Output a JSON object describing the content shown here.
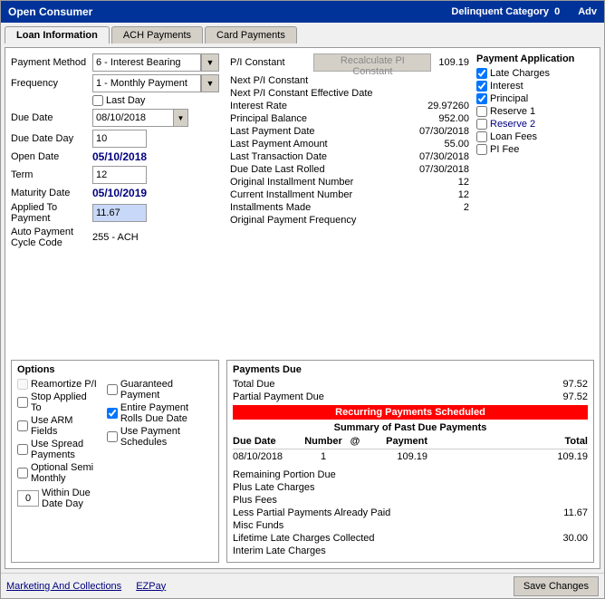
{
  "window": {
    "title": "Open Consumer",
    "delinquent_label": "Delinquent Category",
    "delinquent_value": "0",
    "adv_label": "Adv"
  },
  "tabs": [
    {
      "label": "Loan Information",
      "active": true
    },
    {
      "label": "ACH Payments",
      "active": false
    },
    {
      "label": "Card Payments",
      "active": false
    }
  ],
  "loan_info": {
    "payment_method_label": "Payment Method",
    "payment_method_value": "6 - Interest Bearing",
    "frequency_label": "Frequency",
    "frequency_value": "1 - Monthly Payment",
    "last_day_label": "Last Day",
    "due_date_label": "Due Date",
    "due_date_value": "08/10/2018",
    "due_date_day_label": "Due Date Day",
    "due_date_day_value": "10",
    "open_date_label": "Open Date",
    "open_date_value": "05/10/2018",
    "term_label": "Term",
    "term_value": "12",
    "maturity_date_label": "Maturity Date",
    "maturity_date_value": "05/10/2019",
    "applied_label": "Applied To Payment",
    "applied_value": "11.67",
    "auto_payment_label": "Auto Payment Cycle Code",
    "auto_payment_value": "255 - ACH"
  },
  "pi_section": {
    "pi_constant_label": "P/I Constant",
    "recalc_label": "Recalculate PI Constant",
    "pi_value": "109.19",
    "next_pi_label": "Next P/I Constant",
    "next_pi_eff_label": "Next P/I Constant Effective Date",
    "interest_rate_label": "Interest Rate",
    "interest_rate_value": "29.97260",
    "principal_balance_label": "Principal Balance",
    "principal_balance_value": "952.00",
    "last_payment_date_label": "Last Payment Date",
    "last_payment_date_value": "07/30/2018",
    "last_payment_amount_label": "Last Payment Amount",
    "last_payment_amount_value": "55.00",
    "last_transaction_label": "Last Transaction Date",
    "last_transaction_value": "07/30/2018",
    "due_date_rolled_label": "Due Date Last Rolled",
    "due_date_rolled_value": "07/30/2018",
    "original_installment_label": "Original Installment Number",
    "original_installment_value": "12",
    "current_installment_label": "Current Installment Number",
    "current_installment_value": "12",
    "installments_made_label": "Installments Made",
    "installments_made_value": "2",
    "original_freq_label": "Original Payment Frequency"
  },
  "payment_application": {
    "title": "Payment Application",
    "items": [
      {
        "label": "Late Charges",
        "checked": true,
        "color": "normal"
      },
      {
        "label": "Interest",
        "checked": true,
        "color": "normal"
      },
      {
        "label": "Principal",
        "checked": true,
        "color": "normal"
      },
      {
        "label": "Reserve 1",
        "checked": false,
        "color": "normal"
      },
      {
        "label": "Reserve 2",
        "checked": false,
        "color": "blue"
      },
      {
        "label": "Loan Fees",
        "checked": false,
        "color": "normal"
      },
      {
        "label": "PI Fee",
        "checked": false,
        "color": "normal"
      }
    ]
  },
  "options": {
    "title": "Options",
    "col1": [
      {
        "label": "Reamortize P/I",
        "checked": false,
        "disabled": true
      },
      {
        "label": "Stop Applied To",
        "checked": false
      },
      {
        "label": "Use ARM Fields",
        "checked": false
      },
      {
        "label": "Use Spread Payments",
        "checked": false
      },
      {
        "label": "Optional Semi Monthly",
        "checked": false
      }
    ],
    "col2": [
      {
        "label": "Guaranteed Payment",
        "checked": false
      },
      {
        "label": "Entire Payment Rolls Due Date",
        "checked": true
      },
      {
        "label": "Use Payment Schedules",
        "checked": false
      }
    ],
    "within_label": "Within Due Date Day",
    "within_value": "0"
  },
  "payments_due": {
    "title": "Payments Due",
    "total_due_label": "Total Due",
    "total_due_value": "97.52",
    "partial_due_label": "Partial Payment Due",
    "partial_due_value": "97.52",
    "recurring_label": "Recurring Payments Scheduled",
    "summary_title": "Summary of Past Due Payments",
    "table_headers": [
      "Due Date",
      "Number",
      "@",
      "Payment",
      "Total"
    ],
    "table_rows": [
      {
        "due_date": "08/10/2018",
        "number": "1",
        "at": "",
        "payment": "109.19",
        "total": "109.19"
      }
    ],
    "misc": [
      {
        "label": "Remaining Portion Due",
        "value": ""
      },
      {
        "label": "Plus Late Charges",
        "value": ""
      },
      {
        "label": "Plus Fees",
        "value": ""
      },
      {
        "label": "Less Partial Payments Already Paid",
        "value": "11.67"
      },
      {
        "label": "Misc Funds",
        "value": ""
      },
      {
        "label": "Lifetime Late Charges Collected",
        "value": "30.00"
      },
      {
        "label": "Interim Late Charges",
        "value": ""
      }
    ]
  },
  "bottom_bar": {
    "link1": "Marketing And Collections",
    "link2": "EZPay",
    "save_btn": "Save Changes"
  }
}
